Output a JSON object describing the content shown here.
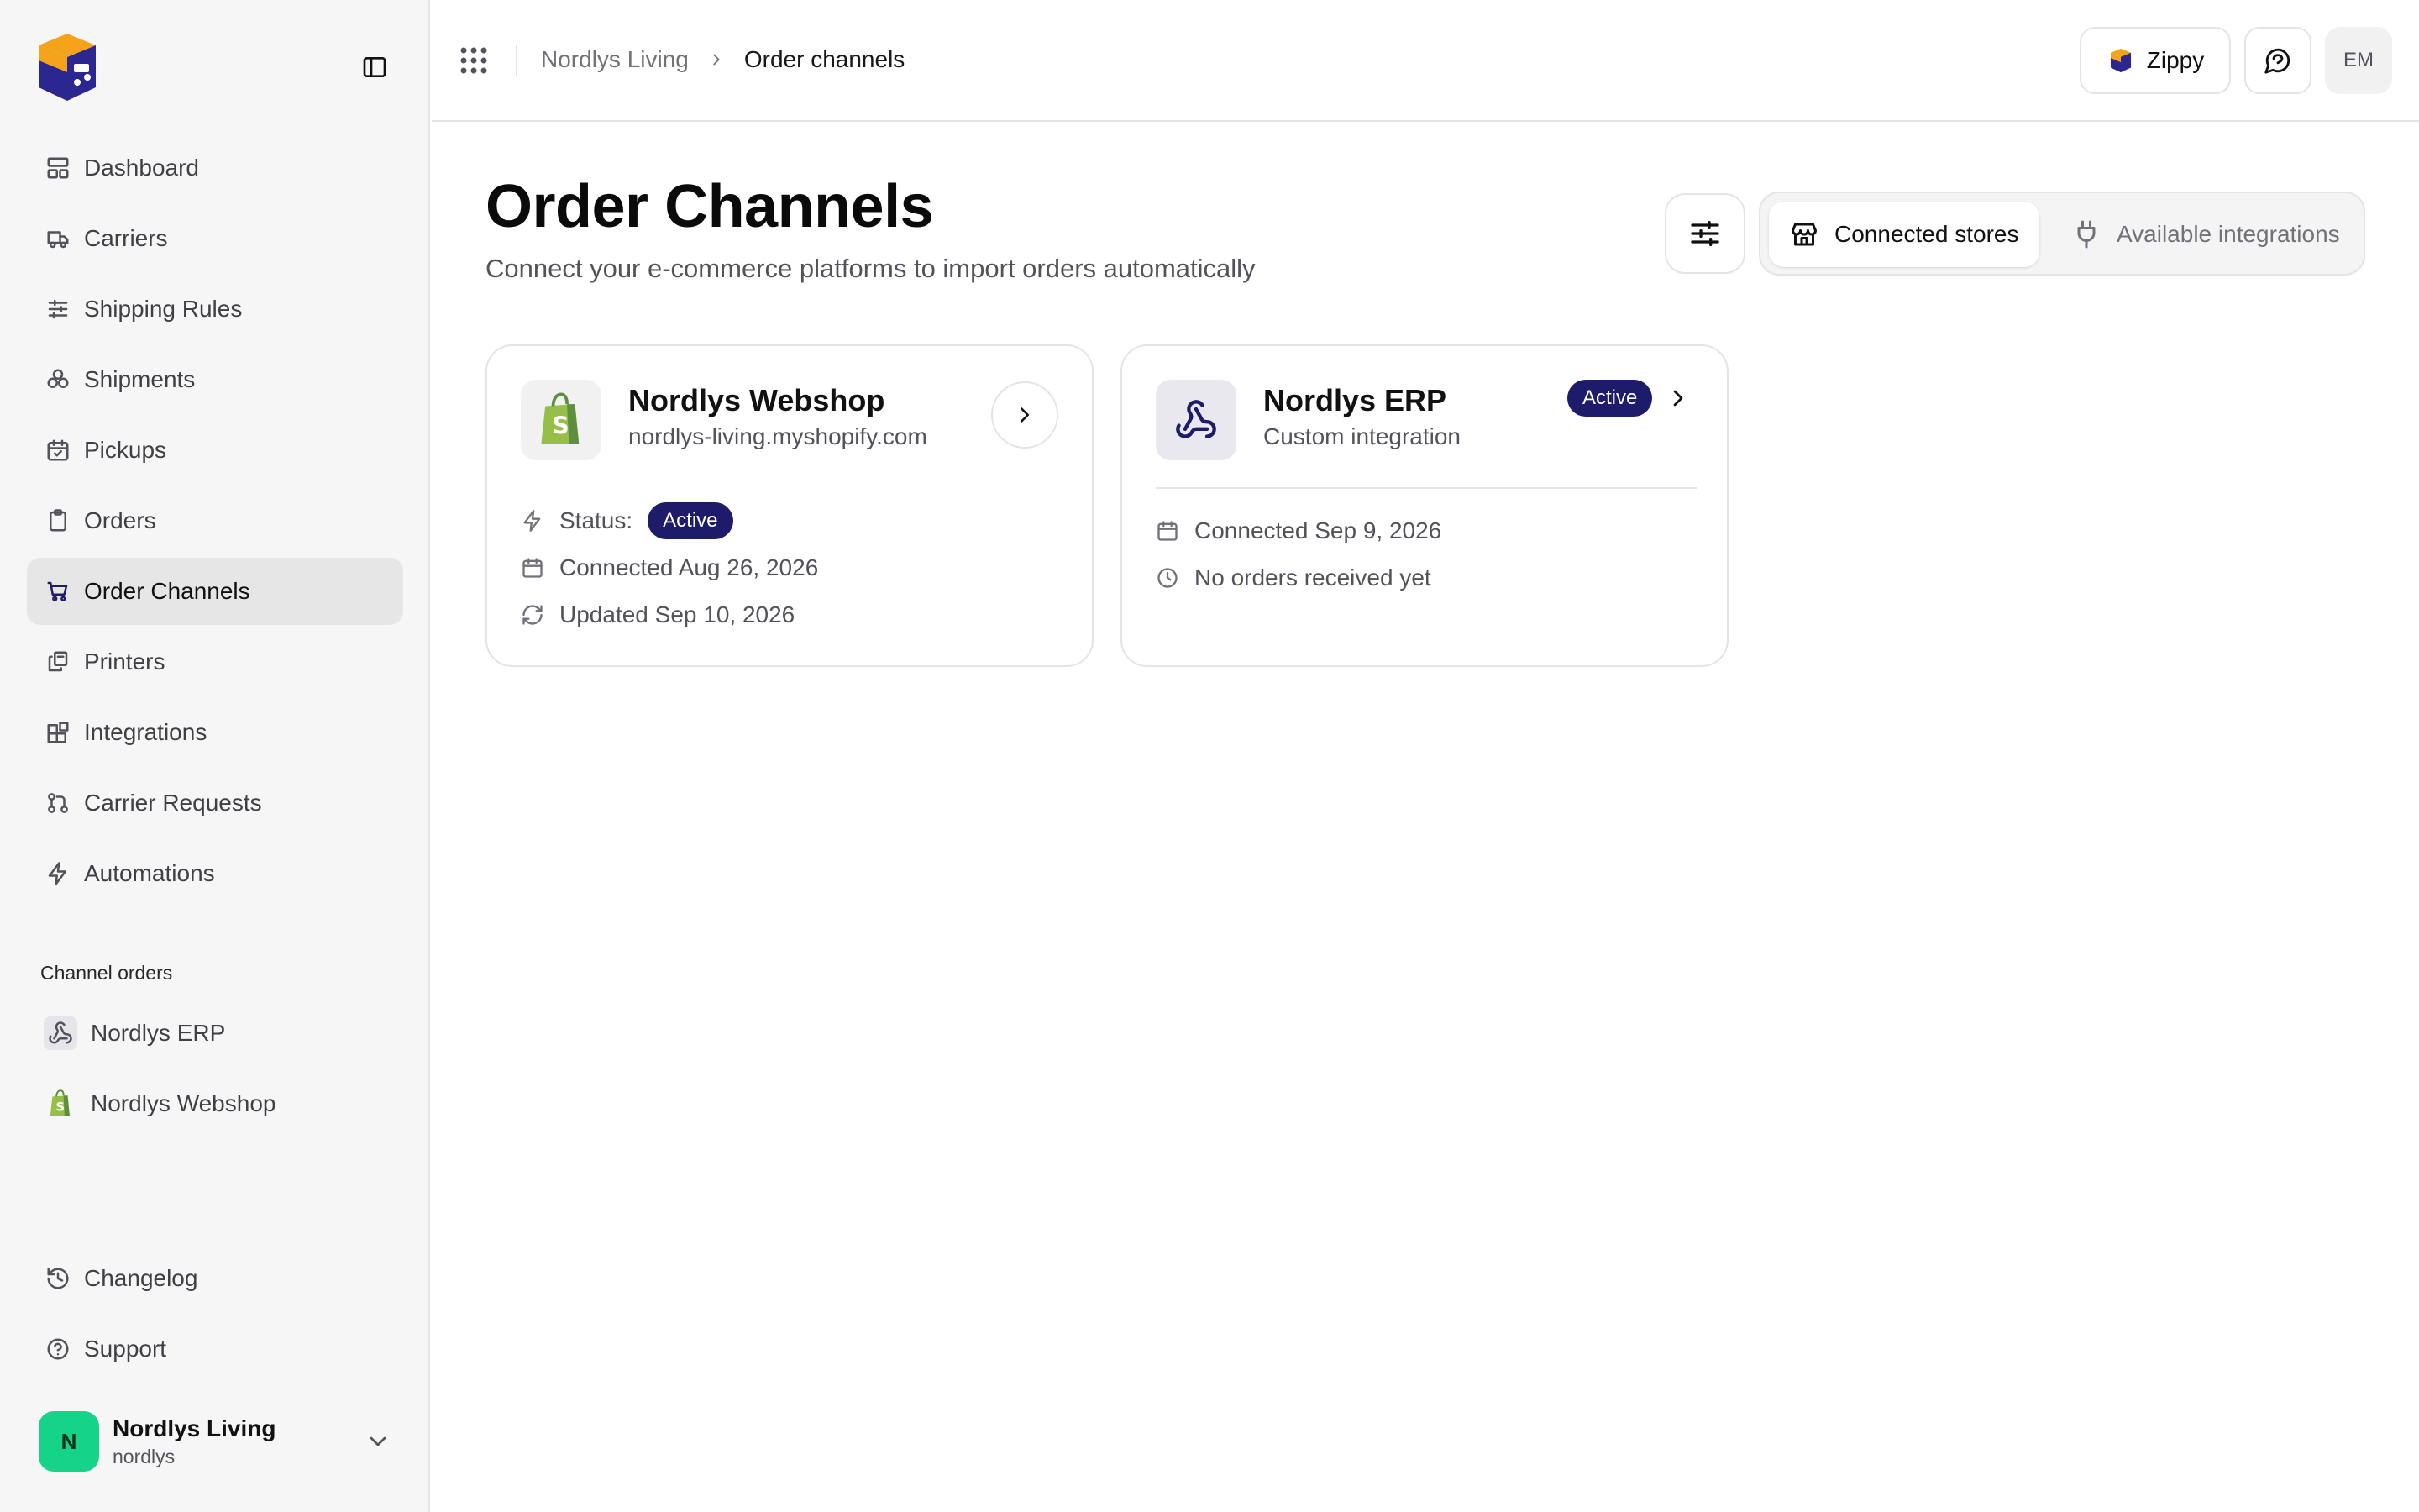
{
  "colors": {
    "brand_indigo": "#1e1b6b",
    "brand_orange": "#f4a31a",
    "avatar_green": "#16d38a",
    "shopify_green": "#95bf47"
  },
  "sidebar": {
    "logo_icon": "zippy-logo",
    "collapse_icon": "sidebar-collapse-icon",
    "nav": [
      {
        "label": "Dashboard",
        "icon": "layout-dashboard-icon"
      },
      {
        "label": "Carriers",
        "icon": "truck-icon"
      },
      {
        "label": "Shipping Rules",
        "icon": "sliders-icon"
      },
      {
        "label": "Shipments",
        "icon": "boxes-icon"
      },
      {
        "label": "Pickups",
        "icon": "calendar-check-icon"
      },
      {
        "label": "Orders",
        "icon": "clipboard-icon"
      },
      {
        "label": "Order Channels",
        "icon": "cart-icon",
        "active": true
      },
      {
        "label": "Printers",
        "icon": "printers-icon"
      },
      {
        "label": "Integrations",
        "icon": "blocks-icon"
      },
      {
        "label": "Carrier Requests",
        "icon": "git-pull-request-icon"
      },
      {
        "label": "Automations",
        "icon": "zap-icon"
      }
    ],
    "channel_section_label": "Channel orders",
    "channels": [
      {
        "label": "Nordlys ERP",
        "icon": "webhook-icon"
      },
      {
        "label": "Nordlys Webshop",
        "icon": "shopify-icon"
      }
    ],
    "bottom": [
      {
        "label": "Changelog",
        "icon": "history-icon"
      },
      {
        "label": "Support",
        "icon": "help-circle-icon"
      }
    ],
    "user": {
      "initial": "N",
      "name": "Nordlys Living",
      "handle": "nordlys"
    }
  },
  "topbar": {
    "breadcrumb": [
      "Nordlys Living",
      "Order channels"
    ],
    "zippy_label": "Zippy",
    "avatar_initials": "EM"
  },
  "main": {
    "title": "Order Channels",
    "subtitle": "Connect your e-commerce platforms to import orders automatically",
    "tabs": [
      {
        "label": "Connected stores",
        "icon": "store-icon",
        "selected": true
      },
      {
        "label": "Available integrations",
        "icon": "plug-icon",
        "selected": false
      }
    ],
    "cards": [
      {
        "name": "Nordlys Webshop",
        "subtitle": "nordlys-living.myshopify.com",
        "status_label": "Status:",
        "status": "Active",
        "connected": "Connected Aug 26, 2026",
        "updated": "Updated Sep 10, 2026"
      },
      {
        "name": "Nordlys ERP",
        "subtitle": "Custom integration",
        "status": "Active",
        "connected": "Connected Sep 9, 2026",
        "orders": "No orders received yet"
      }
    ]
  }
}
